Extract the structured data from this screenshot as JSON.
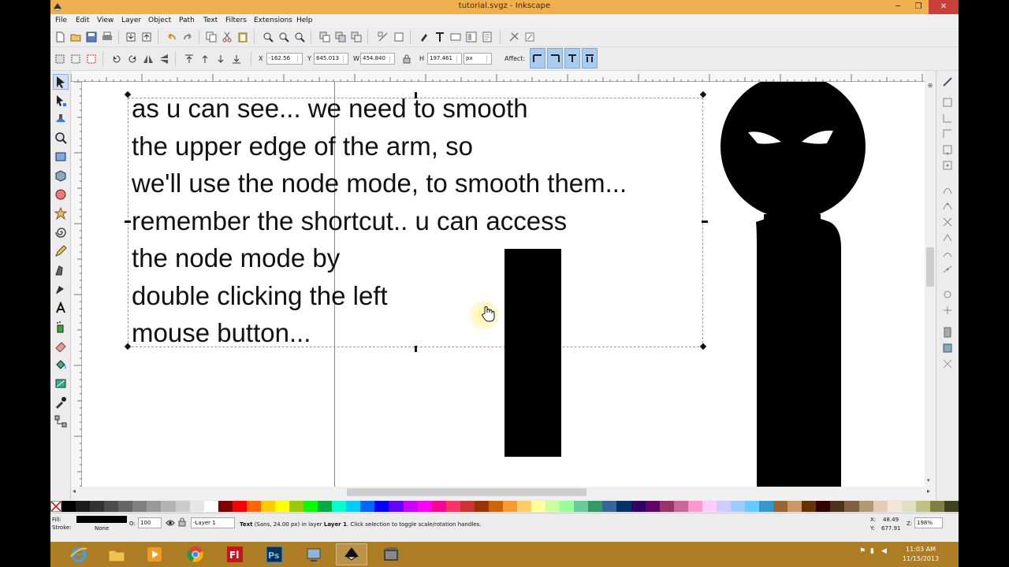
{
  "window": {
    "title": "tutorial.svgz - Inkscape"
  },
  "menu": [
    "File",
    "Edit",
    "View",
    "Layer",
    "Object",
    "Path",
    "Text",
    "Filters",
    "Extensions",
    "Help"
  ],
  "controls": {
    "x_label": "X",
    "x_value": "-162.56",
    "y_label": "Y",
    "y_value": "645.013",
    "w_label": "W",
    "w_value": "454.840",
    "h_label": "H",
    "h_value": "197.461",
    "unit": "px",
    "affect_label": "Affect:"
  },
  "canvas_text": [
    "as u can see... we need to smooth",
    "the upper edge of the arm, so",
    "we'll use the node mode, to smooth them...",
    "remember the shortcut.. u can access",
    "the node mode by",
    "double clicking the left",
    "mouse button..."
  ],
  "palette_colors": [
    "#000000",
    "#1a1a1a",
    "#333333",
    "#4d4d4d",
    "#666666",
    "#808080",
    "#999999",
    "#b3b3b3",
    "#cccccc",
    "#e6e6e6",
    "#ffffff",
    "#800000",
    "#ff0000",
    "#ff6600",
    "#ffcc00",
    "#ffff00",
    "#99cc00",
    "#00ff00",
    "#00aa44",
    "#00ffcc",
    "#00ccff",
    "#0066ff",
    "#0000ff",
    "#6600ff",
    "#cc00ff",
    "#ff00ff",
    "#ff0099",
    "#ff3366",
    "#cc3333",
    "#993300",
    "#cc6600",
    "#ff9933",
    "#ffcc66",
    "#ffff99",
    "#ccff99",
    "#99ff99",
    "#66cc99",
    "#339966",
    "#336699",
    "#003366",
    "#330066",
    "#660066",
    "#993366",
    "#cc6699",
    "#ff99cc",
    "#ffccff",
    "#ccccff",
    "#99ccff",
    "#66ccff",
    "#3399cc",
    "#996633",
    "#cc9966",
    "#663300",
    "#330000",
    "#4d3319",
    "#806040",
    "#b39973",
    "#e6ccb3",
    "#f2e6d9",
    "#e0e0c0",
    "#c0c080",
    "#808040",
    "#404020"
  ],
  "status": {
    "fill_label": "Fill:",
    "stroke_label": "Stroke:",
    "stroke_value": "None",
    "opacity_label": "O:",
    "opacity_value": "100",
    "layer_value": "-Layer 1",
    "message_bold": "Text",
    "message_rest": " (Sans, 24.00 px) in layer ",
    "message_layer": "Layer 1",
    "message_end": ". Click selection to toggle scale/rotation handles.",
    "cursor_x_label": "X:",
    "cursor_x": "48.49",
    "cursor_y_label": "Y:",
    "cursor_y": "677.91",
    "zoom_label": "Z:",
    "zoom_value": "198%"
  },
  "taskbar": {
    "time": "11:03 AM",
    "date": "11/15/2013",
    "apps": [
      "internet-explorer-icon",
      "file-explorer-icon",
      "media-player-icon",
      "chrome-icon",
      "flash-icon",
      "photoshop-icon",
      "app-icon",
      "inkscape-icon",
      "video-icon"
    ]
  }
}
